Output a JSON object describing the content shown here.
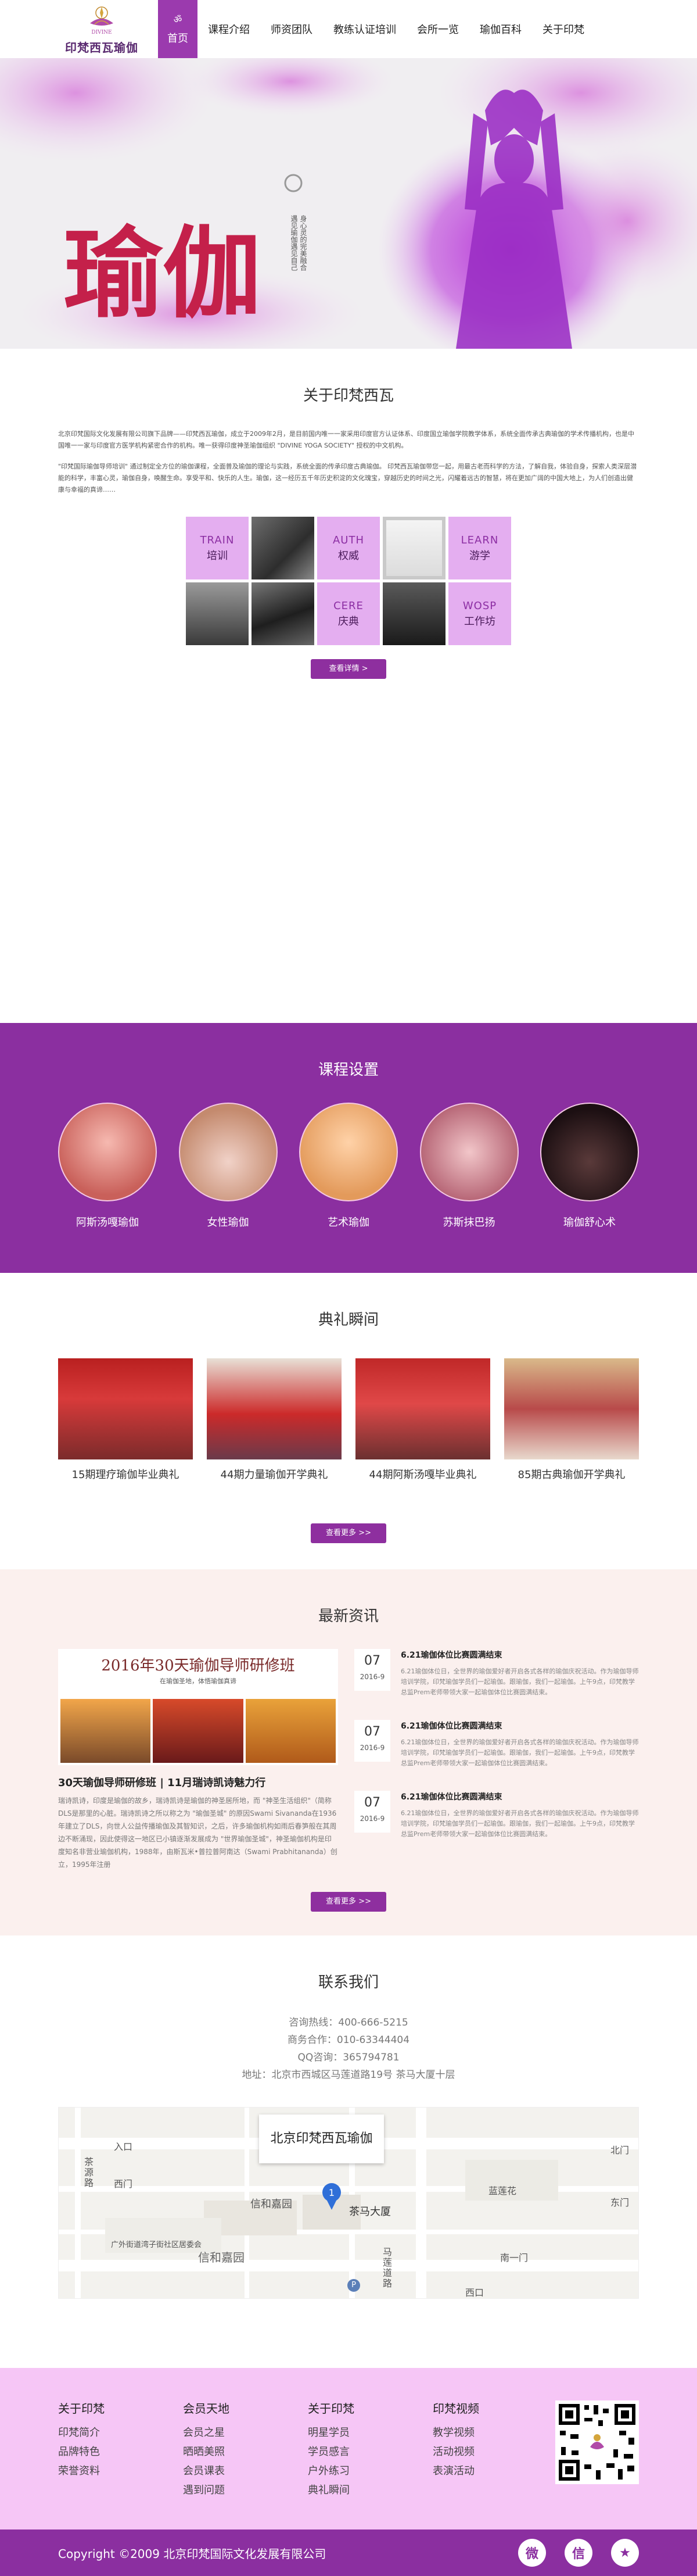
{
  "header": {
    "logo_text": "印梵西瓦瑜伽",
    "logo_latin": "DIVINE",
    "nav": [
      {
        "label": "首页",
        "active": true
      },
      {
        "label": "课程介绍"
      },
      {
        "label": "师资团队"
      },
      {
        "label": "教练认证培训"
      },
      {
        "label": "会所一览"
      },
      {
        "label": "瑜伽百科"
      },
      {
        "label": "关于印梵"
      }
    ]
  },
  "hero": {
    "title": "瑜伽",
    "vertical_text": [
      "身心灵的完美融合",
      "遇见瑜伽遇见自己"
    ]
  },
  "about": {
    "title": "关于印梵西瓦",
    "paragraphs": [
      "北京印梵国际文化发展有限公司旗下品牌——印梵西瓦瑜伽，成立于2009年2月，是目前国内唯一一家采用印度官方认证体系、印度国立瑜伽学院教学体系，系统全面传承古典瑜伽的学术传播机构，也是中国唯一一家与印度官方医学机构紧密合作的机构。唯一获得印度神圣瑜伽组织 \"DIVINE YOGA SOCIETY\" 授权的中文机构。",
      "\"印梵国际瑜伽导师培训\" 通过制定全方位的瑜伽课程，全面普及瑜伽的理论与实践，系统全面的传承印度古典瑜伽。 印梵西瓦瑜伽带您一起，用最古老而科学的方法，了解自我，体验自身，探索人类深层潜能的科学，丰富心灵，瑜伽自身，唤醒生命。享受平和、快乐的人生。瑜伽，这一经历五千年历史积淀的文化瑰宝，穿越历史的时间之光，闪耀着远古的智慧，将在更加广阔的中国大地上，为人们创造出健康与幸福的真谛……"
    ],
    "tiles": [
      {
        "en": "TRAIN",
        "cn": "培训"
      },
      {
        "en": "AUTH",
        "cn": "权威"
      },
      {
        "en": "LEARN",
        "cn": "游学"
      },
      {
        "en": "CERE",
        "cn": "庆典"
      },
      {
        "en": "WOSP",
        "cn": "工作坊"
      }
    ],
    "button": "查看详情"
  },
  "courses": {
    "title": "课程设置",
    "items": [
      "阿斯汤嘎瑜伽",
      "女性瑜伽",
      "艺术瑜伽",
      "苏斯抹巴扬",
      "瑜伽舒心术"
    ]
  },
  "ceremony": {
    "title": "典礼瞬间",
    "items": [
      "15期理疗瑜伽毕业典礼",
      "44期力量瑜伽开学典礼",
      "44期阿斯汤嘎毕业典礼",
      "85期古典瑜伽开学典礼"
    ],
    "button": "查看更多"
  },
  "news": {
    "title": "最新资讯",
    "feature": {
      "banner_title": "2016年30天瑜伽导师研修班",
      "banner_sub": "在瑜伽圣地，体悟瑜伽真谛",
      "title": "30天瑜伽导师研修班 | 11月瑞诗凯诗魅力行",
      "desc": "瑞诗凯诗，印度是瑜伽的故乡，瑞诗凯诗是瑜伽的神圣居所地，而 \"神圣生活组织\"（简称DLS是那里的心脏。瑞诗凯诗之所以称之为 \"瑜伽圣城\" 的原因Swami Sivananda在1936年建立了DLS，向世人公益传播瑜伽及其智知识，之后，许多瑜伽机构如雨后春笋般在其周边不断涌现，因此使得这一地区已小镇逐渐发展成为 \"世界瑜伽圣城\"，神圣瑜伽机构是印度知名非营业瑜伽机构，1988年，由斯瓦米•普拉普阿南达（Swami Prabhitananda）创立，1995年注册"
    },
    "list": [
      {
        "day": "07",
        "ym": "2016-9",
        "title": "6.21瑜伽体位比赛圆满结束",
        "desc": "6.21瑜伽体位日，全世界的瑜伽爱好者开启各式各样的瑜伽庆祝活动。作为瑜伽导师培训学院，印梵瑜伽学员们一起瑜伽。跟瑜伽，我们一起瑜伽。上午9点，印梵教学总监Prem老师带领大家一起瑜伽体位比赛圆满结束。"
      },
      {
        "day": "07",
        "ym": "2016-9",
        "title": "6.21瑜伽体位比赛圆满结束",
        "desc": "6.21瑜伽体位日，全世界的瑜伽爱好者开启各式各样的瑜伽庆祝活动。作为瑜伽导师培训学院，印梵瑜伽学员们一起瑜伽。跟瑜伽，我们一起瑜伽。上午9点，印梵教学总监Prem老师带领大家一起瑜伽体位比赛圆满结束。"
      },
      {
        "day": "07",
        "ym": "2016-9",
        "title": "6.21瑜伽体位比赛圆满结束",
        "desc": "6.21瑜伽体位日，全世界的瑜伽爱好者开启各式各样的瑜伽庆祝活动。作为瑜伽导师培训学院，印梵瑜伽学员们一起瑜伽。跟瑜伽，我们一起瑜伽。上午9点，印梵教学总监Prem老师带领大家一起瑜伽体位比赛圆满结束。"
      }
    ],
    "button": "查看更多"
  },
  "contact": {
    "title": "联系我们",
    "lines": [
      "咨询热线：400-666-5215",
      "商务合作：010-63344404",
      "QQ咨询：365794781",
      "地址：北京市西城区马莲道路19号 茶马大厦十层"
    ],
    "map": {
      "label": "北京印梵西瓦瑜伽",
      "pin": "1",
      "places": [
        "入口",
        "茶源路",
        "西门",
        "信和嘉园",
        "茶马大厦",
        "蓝莲花",
        "北门",
        "东门",
        "南一门",
        "广外街道湾子街社区居委会",
        "信和嘉园",
        "马莲道路",
        "西口",
        "P"
      ]
    }
  },
  "footer": {
    "columns": [
      {
        "title": "关于印梵",
        "links": [
          "印梵简介",
          "品牌特色",
          "荣誉资料"
        ]
      },
      {
        "title": "会员天地",
        "links": [
          "会员之星",
          "晒晒美照",
          "会员课表",
          "遇到问题"
        ]
      },
      {
        "title": "关于印梵",
        "links": [
          "明星学员",
          "学员感言",
          "户外练习",
          "典礼瞬间"
        ]
      },
      {
        "title": "印梵视频",
        "links": [
          "教学视频",
          "活动视频",
          "表演活动"
        ]
      }
    ],
    "copyright": "Copyright ©2009   北京印梵国际文化发展有限公司",
    "socials": [
      {
        "icon": "weibo-icon",
        "glyph": "微"
      },
      {
        "icon": "wechat-icon",
        "glyph": "信"
      },
      {
        "icon": "star-icon",
        "glyph": "★"
      }
    ]
  },
  "colors": {
    "primary": "#8b2fa0",
    "nav_active": "#9b3aae",
    "tile": "#e4aef0",
    "footer_bg": "#f6c6f6",
    "news_bg": "#fbf0ee"
  }
}
